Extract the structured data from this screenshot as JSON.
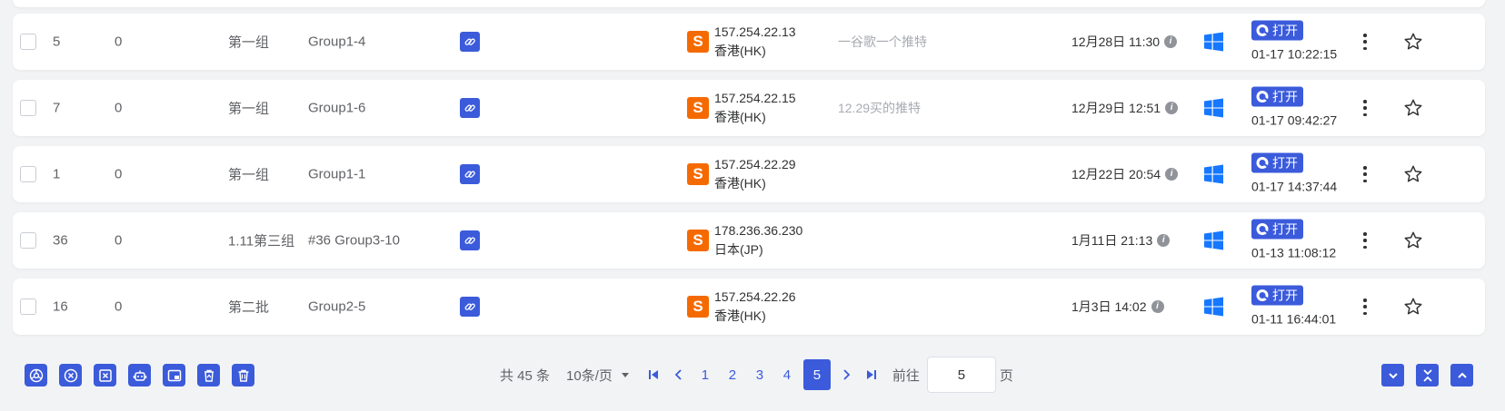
{
  "rows": [
    {
      "id": "5",
      "count": "0",
      "group": "第一组",
      "name": "Group1-4",
      "proxy_badge": "S",
      "ip": "157.254.22.13",
      "region": "香港(HK)",
      "note": "一谷歌一个推特",
      "created": "12月28日 11:30",
      "open_label": "打开",
      "open_time": "01-17 10:22:15"
    },
    {
      "id": "7",
      "count": "0",
      "group": "第一组",
      "name": "Group1-6",
      "proxy_badge": "S",
      "ip": "157.254.22.15",
      "region": "香港(HK)",
      "note": "12.29买的推特",
      "created": "12月29日 12:51",
      "open_label": "打开",
      "open_time": "01-17 09:42:27"
    },
    {
      "id": "1",
      "count": "0",
      "group": "第一组",
      "name": "Group1-1",
      "proxy_badge": "S",
      "ip": "157.254.22.29",
      "region": "香港(HK)",
      "note": "",
      "created": "12月22日 20:54",
      "open_label": "打开",
      "open_time": "01-17 14:37:44"
    },
    {
      "id": "36",
      "count": "0",
      "group": "1.11第三组",
      "name": "#36 Group3-10",
      "proxy_badge": "S",
      "ip": "178.236.36.230",
      "region": "日本(JP)",
      "note": "",
      "created": "1月11日 21:13",
      "open_label": "打开",
      "open_time": "01-13 11:08:12"
    },
    {
      "id": "16",
      "count": "0",
      "group": "第二批",
      "name": "Group2-5",
      "proxy_badge": "S",
      "ip": "157.254.22.26",
      "region": "香港(HK)",
      "note": "",
      "created": "1月3日 14:02",
      "open_label": "打开",
      "open_time": "01-11 16:44:01"
    }
  ],
  "footer_tools": [
    "chrome-icon",
    "close-circle-icon",
    "close-square-icon",
    "robot-icon",
    "window-icon",
    "trash-restore-icon",
    "trash-icon"
  ],
  "pagination": {
    "total": "共 45 条",
    "page_size": "10条/页",
    "pages": [
      "1",
      "2",
      "3",
      "4",
      "5"
    ],
    "current_page": "5",
    "goto_label": "前往",
    "goto_value": "5",
    "page_suffix": "页"
  },
  "right_buttons": [
    "chevron-down-icon",
    "collapse-icon",
    "chevron-up-icon"
  ],
  "colors": {
    "accent": "#3b5bdb",
    "proxy_badge": "#f56a00",
    "windows": "#1677ff"
  }
}
